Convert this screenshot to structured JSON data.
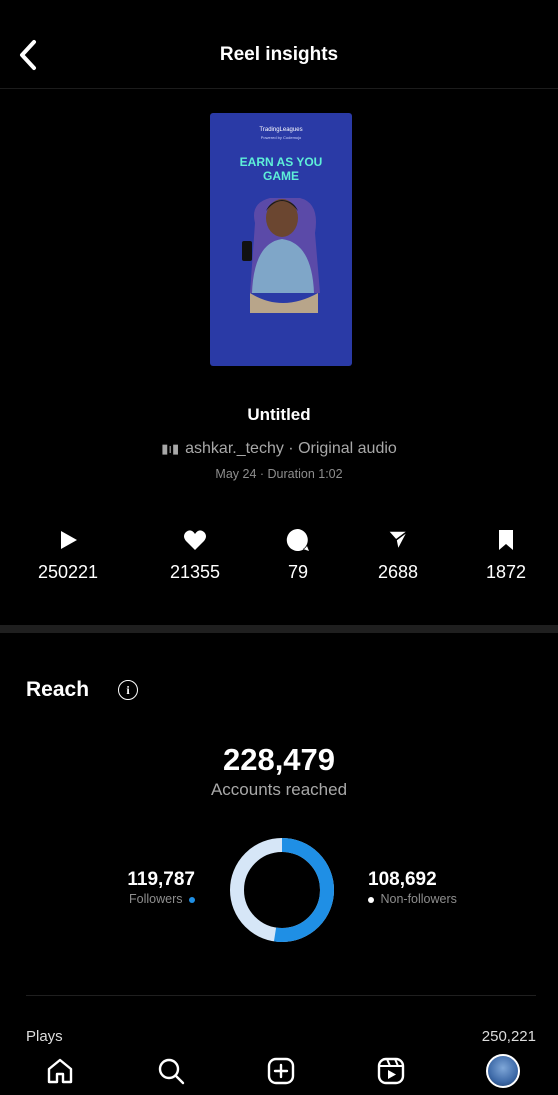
{
  "header": {
    "title": "Reel insights"
  },
  "reel": {
    "thumbnail": {
      "brand": "TradingLeagues",
      "tagline": "Powered by Codemojo",
      "headline_line1": "EARN AS YOU",
      "headline_line2": "GAME"
    },
    "title": "Untitled",
    "audio": "ashkar._techy · Original audio",
    "meta": "May 24 · Duration 1:02"
  },
  "stats": [
    {
      "icon": "play-icon",
      "value": "250221"
    },
    {
      "icon": "heart-icon",
      "value": "21355"
    },
    {
      "icon": "comment-icon",
      "value": "79"
    },
    {
      "icon": "share-icon",
      "value": "2688"
    },
    {
      "icon": "bookmark-icon",
      "value": "1872"
    }
  ],
  "reach": {
    "title": "Reach",
    "accounts_reached": "228,479",
    "accounts_label": "Accounts reached",
    "followers_value": "119,787",
    "followers_label": "Followers",
    "nonfollowers_value": "108,692",
    "nonfollowers_label": "Non-followers",
    "followers_fraction": 0.524,
    "colors": {
      "followers": "#1f8fe5",
      "nonfollowers": "#d6e6f7"
    }
  },
  "plays": {
    "label": "Plays",
    "value": "250,221"
  },
  "nav": [
    "home-icon",
    "search-icon",
    "create-icon",
    "reels-icon",
    "profile-avatar"
  ]
}
